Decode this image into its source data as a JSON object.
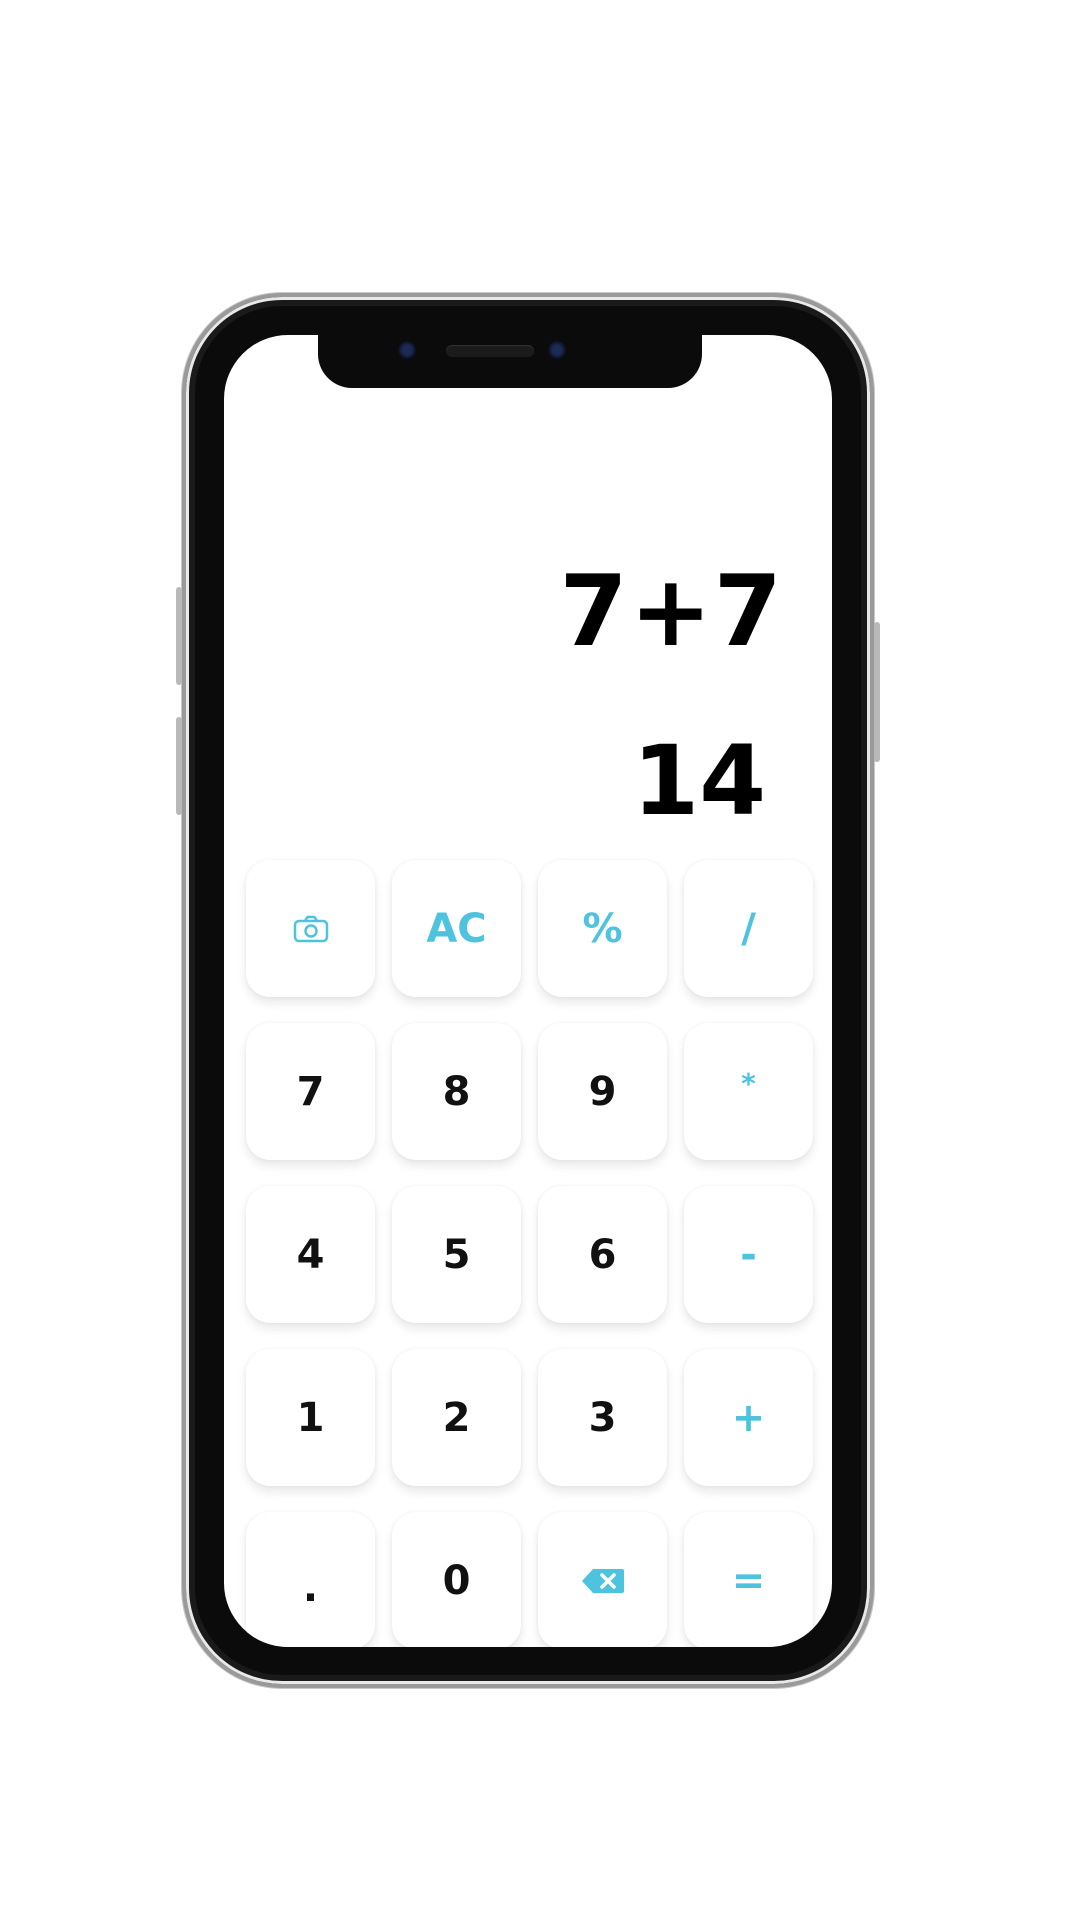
{
  "colors": {
    "accent": "#4ec3e0",
    "text": "#111111",
    "background": "#ffffff"
  },
  "display": {
    "expression": "7+7",
    "result": "14"
  },
  "keypad": {
    "rows": [
      [
        {
          "label": "",
          "icon": "camera-icon",
          "type": "function"
        },
        {
          "label": "AC",
          "type": "function"
        },
        {
          "label": "%",
          "type": "operator"
        },
        {
          "label": "/",
          "type": "operator"
        }
      ],
      [
        {
          "label": "7",
          "type": "digit"
        },
        {
          "label": "8",
          "type": "digit"
        },
        {
          "label": "9",
          "type": "digit"
        },
        {
          "label": "*",
          "type": "operator"
        }
      ],
      [
        {
          "label": "4",
          "type": "digit"
        },
        {
          "label": "5",
          "type": "digit"
        },
        {
          "label": "6",
          "type": "digit"
        },
        {
          "label": "-",
          "type": "operator"
        }
      ],
      [
        {
          "label": "1",
          "type": "digit"
        },
        {
          "label": "2",
          "type": "digit"
        },
        {
          "label": "3",
          "type": "digit"
        },
        {
          "label": "+",
          "type": "operator"
        }
      ],
      [
        {
          "label": ".",
          "type": "digit"
        },
        {
          "label": "0",
          "type": "digit"
        },
        {
          "label": "",
          "icon": "backspace-icon",
          "type": "function"
        },
        {
          "label": "=",
          "type": "operator"
        }
      ]
    ]
  }
}
